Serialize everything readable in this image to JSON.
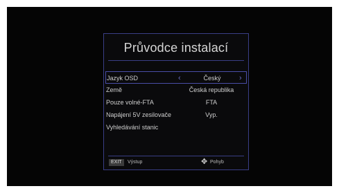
{
  "title": "Průvodce instalací",
  "rows": [
    {
      "label": "Jazyk OSD",
      "value": "Český"
    },
    {
      "label": "Země",
      "value": "Česká republika"
    },
    {
      "label": "Pouze volné-FTA",
      "value": "FTA"
    },
    {
      "label": "Napájení 5V zesilovače",
      "value": "Vyp."
    },
    {
      "label": "Vyhledávání stanic",
      "value": ""
    }
  ],
  "footer": {
    "exit_key": "EXIT",
    "exit_label": "Výstup",
    "move_label": "Pohyb"
  },
  "icons": {
    "left_arrow": "chevron-left-icon",
    "right_arrow": "chevron-right-icon",
    "move": "dpad-move-icon"
  },
  "colors": {
    "accent": "#3a3e86",
    "highlight_border": "#4a4ea8",
    "arrow": "#6a6ec8"
  }
}
